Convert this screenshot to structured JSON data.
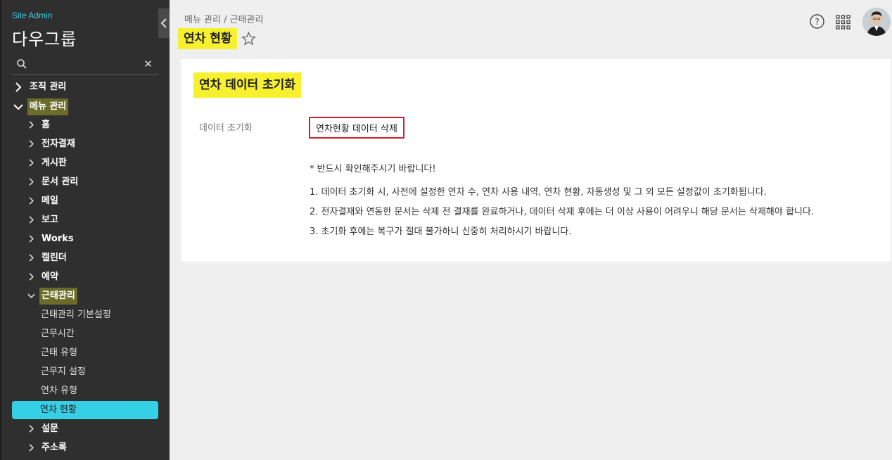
{
  "sidebar": {
    "site_admin": "Site Admin",
    "group_name": "다우그룹",
    "search_placeholder": "",
    "top_items": [
      {
        "label": "조직 관리",
        "expanded": false
      },
      {
        "label": "메뉴 관리",
        "expanded": true
      }
    ],
    "menu_items": [
      {
        "label": "홈"
      },
      {
        "label": "전자결재"
      },
      {
        "label": "게시판"
      },
      {
        "label": "문서 관리"
      },
      {
        "label": "메일"
      },
      {
        "label": "보고"
      },
      {
        "label": "Works"
      },
      {
        "label": "캘린더"
      },
      {
        "label": "예약"
      },
      {
        "label": "근태관리",
        "expanded": true
      }
    ],
    "sub_items": [
      {
        "label": "근태관리 기본설정"
      },
      {
        "label": "근무시간"
      },
      {
        "label": "근태 유형"
      },
      {
        "label": "근무지 설정"
      },
      {
        "label": "연차 유형"
      },
      {
        "label": "연차 현황",
        "active": true
      }
    ],
    "after_items": [
      {
        "label": "설문"
      },
      {
        "label": "주소록"
      }
    ]
  },
  "header": {
    "breadcrumb": "메뉴 관리 / 근태관리",
    "title": "연차 현황"
  },
  "content": {
    "section_title": "연차 데이터 초기화",
    "field_label": "데이터 초기화",
    "delete_button": "연차현황 데이터 삭제",
    "notice_heading": "* 반드시 확인해주시기 바랍니다!",
    "notices": [
      "1. 데이터 초기화 시, 사전에 설정한 연차 수, 연차 사용 내역, 연차 현황, 자동생성 및 그 외 모든 설정값이 초기화됩니다.",
      "2. 전자결재와 연동한 문서는 삭제 전 결재를 완료하거나, 데이터 삭제 후에는 더 이상 사용이 어려우니 해당 문서는 삭제해야 합니다.",
      "3. 초기화 후에는 복구가 절대 불가하니 신중히 처리하시기 바랍니다."
    ]
  },
  "colors": {
    "sidebar_bg": "#2f2f2f",
    "accent": "#35d0e6",
    "highlight_yellow": "#f7f02e",
    "danger": "#d21f2f"
  }
}
